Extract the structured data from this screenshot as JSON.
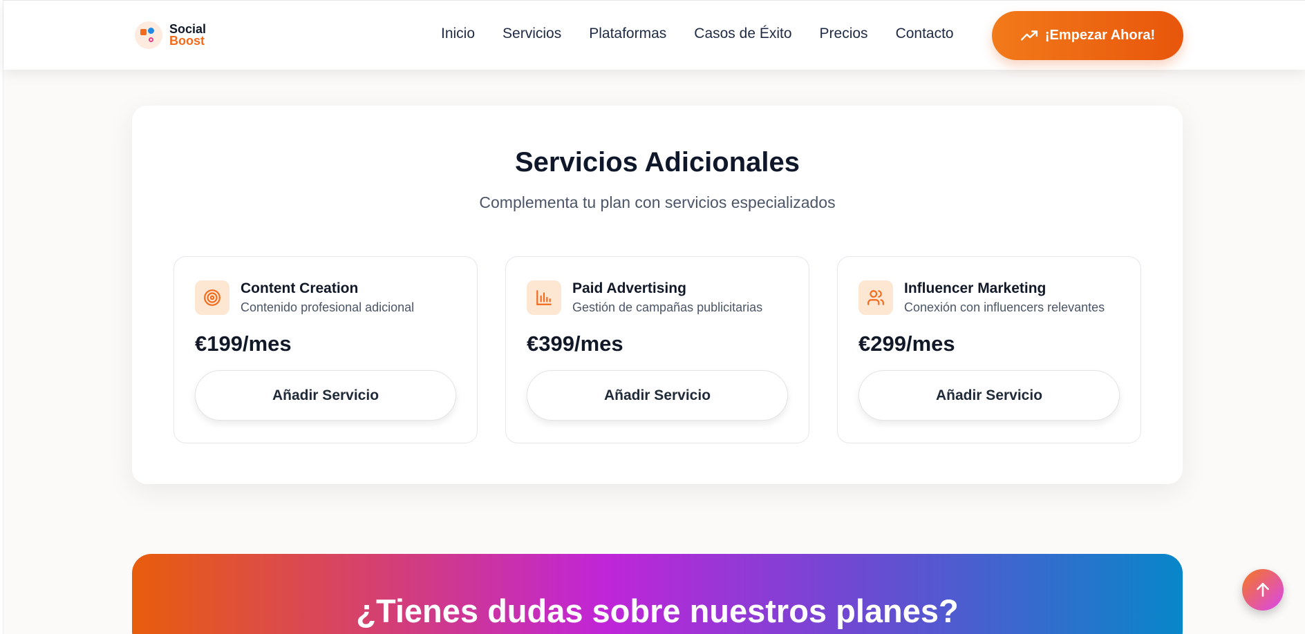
{
  "brand": {
    "line1": "Social",
    "line2": "Boost"
  },
  "nav": {
    "items": [
      "Inicio",
      "Servicios",
      "Plataformas",
      "Casos de Éxito",
      "Precios",
      "Contacto"
    ],
    "cta_label": "¡Empezar Ahora!"
  },
  "services": {
    "title": "Servicios Adicionales",
    "subtitle": "Complementa tu plan con servicios especializados",
    "items": [
      {
        "icon": "target-icon",
        "name": "Content Creation",
        "description": "Contenido profesional adicional",
        "price": "€199/mes",
        "button": "Añadir Servicio"
      },
      {
        "icon": "bar-chart-icon",
        "name": "Paid Advertising",
        "description": "Gestión de campañas publicitarias",
        "price": "€399/mes",
        "button": "Añadir Servicio"
      },
      {
        "icon": "users-icon",
        "name": "Influencer Marketing",
        "description": "Conexión con influencers relevantes",
        "price": "€299/mes",
        "button": "Añadir Servicio"
      }
    ]
  },
  "banner": {
    "title": "¿Tienes dudas sobre nuestros planes?"
  },
  "colors": {
    "accent": "#f26b1d",
    "icon_bg": "#fde6d2",
    "text_dark": "#0f172a"
  }
}
